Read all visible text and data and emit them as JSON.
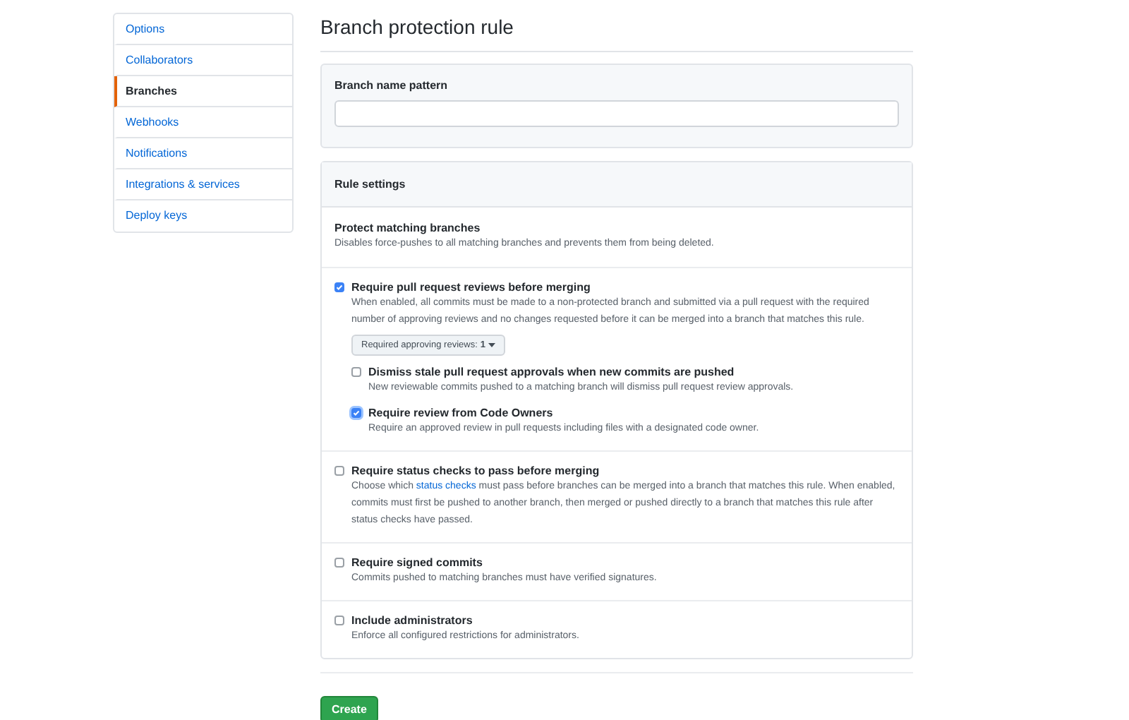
{
  "sidebar": {
    "items": [
      {
        "label": "Options",
        "selected": false
      },
      {
        "label": "Collaborators",
        "selected": false
      },
      {
        "label": "Branches",
        "selected": true
      },
      {
        "label": "Webhooks",
        "selected": false
      },
      {
        "label": "Notifications",
        "selected": false
      },
      {
        "label": "Integrations & services",
        "selected": false
      },
      {
        "label": "Deploy keys",
        "selected": false
      }
    ]
  },
  "title": "Branch protection rule",
  "pattern": {
    "label": "Branch name pattern"
  },
  "rule_settings": {
    "header": "Rule settings",
    "protect": {
      "title": "Protect matching branches",
      "description": "Disables force-pushes to all matching branches and prevents them from being deleted."
    },
    "rules": [
      {
        "label": "Require pull request reviews before merging",
        "checked": true,
        "description": [
          {
            "kind": "text",
            "text": "When enabled, all commits must be made to a non-protected branch and submitted via a pull request with the required number of approving reviews and no changes requested before it can be merged into a branch that matches this rule."
          }
        ],
        "dropdown": {
          "label": "Required approving reviews:",
          "value": "1"
        },
        "children": [
          {
            "label": "Dismiss stale pull request approvals when new commits are pushed",
            "checked": false,
            "focused": false,
            "description": "New reviewable commits pushed to a matching branch will dismiss pull request review approvals."
          },
          {
            "label": "Require review from Code Owners",
            "checked": true,
            "focused": true,
            "description": "Require an approved review in pull requests including files with a designated code owner."
          }
        ]
      },
      {
        "label": "Require status checks to pass before merging",
        "checked": false,
        "description": [
          {
            "kind": "text",
            "text": "Choose which "
          },
          {
            "kind": "link",
            "text": "status checks"
          },
          {
            "kind": "text",
            "text": " must pass before branches can be merged into a branch that matches this rule. When enabled, commits must first be pushed to another branch, then merged or pushed directly to a branch that matches this rule after status checks have passed."
          }
        ]
      },
      {
        "label": "Require signed commits",
        "checked": false,
        "description": [
          {
            "kind": "text",
            "text": "Commits pushed to matching branches must have verified signatures."
          }
        ]
      },
      {
        "label": "Include administrators",
        "checked": false,
        "description": [
          {
            "kind": "text",
            "text": "Enforce all configured restrictions for administrators."
          }
        ]
      }
    ]
  },
  "create_button": "Create"
}
